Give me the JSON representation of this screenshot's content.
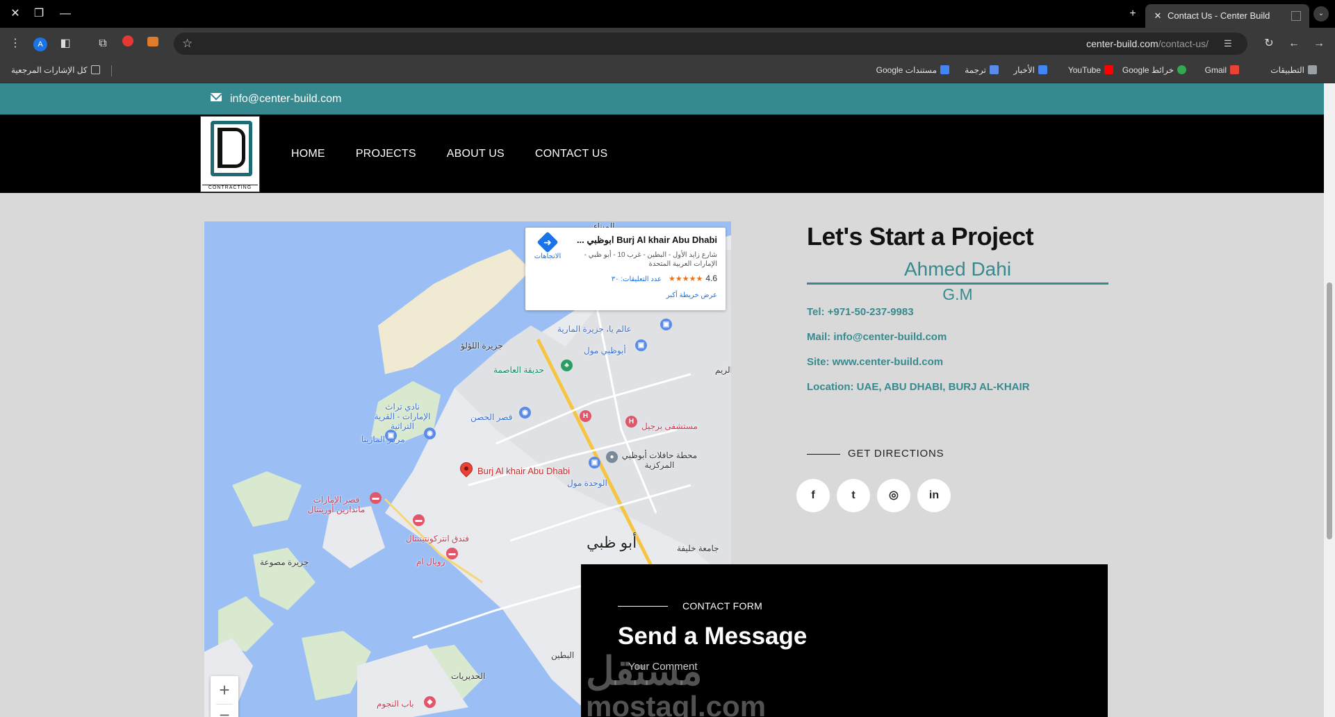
{
  "browser": {
    "tab_title": "Contact Us - Center Build",
    "url_host": "center-build.com",
    "url_path": "/contact-us/",
    "bookmarks": [
      "التطبيقات",
      "Gmail",
      "خرائط Google",
      "YouTube",
      "الأخبار",
      "ترجمة",
      "مستندات Google"
    ],
    "all_bookmarks": "كل الإشارات المرجعية",
    "colors": {
      "chrome_bg": "#000000",
      "toolbar_bg": "#3a3a3a"
    }
  },
  "site": {
    "top_email": "info@center-build.com",
    "logo_text": "CONTRACTING",
    "nav": [
      "HOME",
      "PROJECTS",
      "ABOUT US",
      "CONTACT US"
    ],
    "colors": {
      "accent": "#368a8f",
      "header_bg": "#000000",
      "page_bg": "#d9d9d9"
    }
  },
  "map": {
    "card": {
      "title": "Burj Al khair Abu Dhabi ابوظبي ...",
      "address": "شارع زايد الأول - البطين - غرب 10 - أبو ظبي - الإمارات العربية المتحدة",
      "rating": "4.6",
      "stars": "★★★★★",
      "reviews": "عدد التعليقات: ٣٠",
      "larger_map": "عرض خريطة أكبر",
      "directions": "الاتجاهات"
    },
    "pin_label": "Burj Al khair Abu Dhabi",
    "labels": {
      "lulu": "جزيرة اللؤلؤ",
      "marina_galleria": "عالم يا، جزيرة المارية",
      "mall": "أبوظبي مول",
      "capital_garden": "حديقة العاصمة",
      "heritage": "نادي تراث الإمارات - القرية التراثية",
      "qasr_hosn": "قصر الحصن",
      "burjeel": "مستشفى برجيل",
      "marina": "مركز المارينا",
      "hafilat": "محطة حافلات أبوظبي المركزية",
      "wahda": "الوحدة مول",
      "emirates_palace": "قصر الإمارات ماندارين أورينتال",
      "intercontinental": "فندق انتركونتيننتال",
      "city": "أبو ظبي",
      "sowwah": "جزيرة مصوعة",
      "royal": "رويال ام",
      "khalifa_mosque": "جامعة خليفة",
      "hudairiyat": "الحديريات",
      "bab_nujoum": "باب النجوم",
      "mina": "الميناء",
      "bateen": "البطين",
      "reem": "الريم"
    },
    "zoom_in": "+",
    "zoom_out": "−"
  },
  "contact": {
    "heading": "Let's Start a Project",
    "name": "Ahmed Dahi",
    "role": "G.M",
    "tel": "Tel: +971-50-237-9983",
    "mail": "Mail: info@center-build.com",
    "site": "Site: www.center-build.com",
    "location": "Location: UAE, ABU DHABI, BURJ AL-KHAIR",
    "directions": "GET DIRECTIONS",
    "social": [
      {
        "icon": "facebook-icon",
        "glyph": "f"
      },
      {
        "icon": "twitter-icon",
        "glyph": "t"
      },
      {
        "icon": "instagram-icon",
        "glyph": "◎"
      },
      {
        "icon": "linkedin-icon",
        "glyph": "in"
      }
    ]
  },
  "form": {
    "label": "CONTACT FORM",
    "title": "Send a Message",
    "comment_placeholder": "Your Comment"
  },
  "watermark": {
    "arabic": "مستقل",
    "latin": "mostaql.com"
  }
}
